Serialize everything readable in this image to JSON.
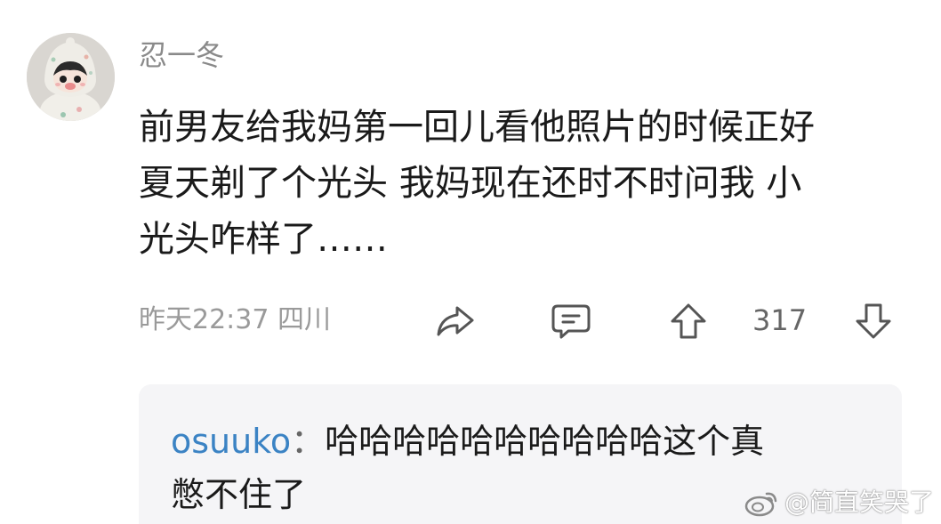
{
  "comment": {
    "username": "忍一冬",
    "text_lines": [
      "前男友给我妈第一回儿看他照片的时候正好",
      "夏天剃了个光头 我妈现在还时不时问我 小",
      "光头咋样了……"
    ],
    "timestamp_location": "昨天22:37 四川",
    "like_count": "317",
    "icons": {
      "share": "share-icon",
      "reply": "comment-icon",
      "upvote": "upvote-arrow-icon",
      "downvote": "downvote-arrow-icon"
    }
  },
  "reply": {
    "author": "osuuko",
    "separator": "：",
    "text_line1": "哈哈哈哈哈哈哈哈哈哈这个真",
    "text_line2": "憋不住了"
  },
  "watermark": {
    "text": "@简直笑哭了",
    "icon": "weibo-logo-icon"
  },
  "colors": {
    "username": "#8a8a8a",
    "reply_author": "#3b83c4",
    "reply_background": "#f5f5f7"
  }
}
